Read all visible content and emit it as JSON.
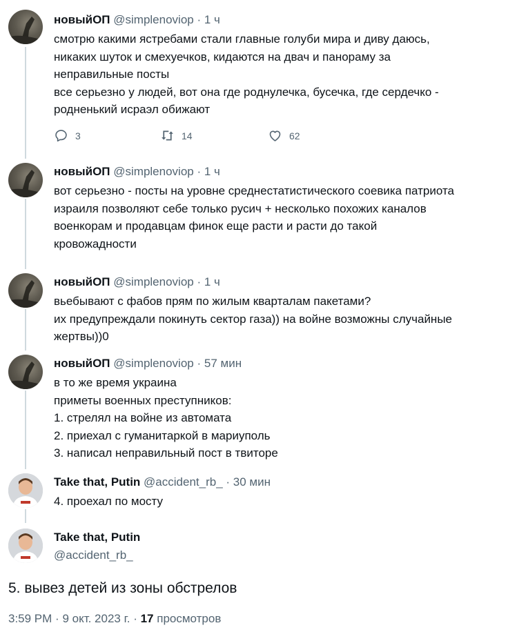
{
  "thread": [
    {
      "name": "новыйОП",
      "handle": "@simplenoviop",
      "sep": "·",
      "time": "1 ч",
      "lines": [
        "смотрю какими ястребами стали главные голуби мира и диву даюсь,",
        "никаких шуток и смехуечков, кидаются на двач и панораму за",
        "неправильные посты",
        "все серьезно у людей, вот она где роднулечка, бусечка, где сердечко -",
        "родненький исраэл обижают"
      ],
      "actions": {
        "replies": "3",
        "retweets": "14",
        "likes": "62"
      }
    },
    {
      "name": "новыйОП",
      "handle": "@simplenoviop",
      "sep": "·",
      "time": "1 ч",
      "lines": [
        "вот серьезно - посты на уровне среднестатистического соевика патриота",
        "израиля позволяют себе только русич + несколько похожих каналов",
        "военкорам и продавцам финок еще расти и расти до такой",
        "кровожадности"
      ]
    },
    {
      "name": "новыйОП",
      "handle": "@simplenoviop",
      "sep": "·",
      "time": "1 ч",
      "lines": [
        "вьебывают с фабов прям по жилым кварталам пакетами?",
        "их предупреждали покинуть сектор газа)) на войне возможны случайные",
        "жертвы))0"
      ]
    },
    {
      "name": "новыйОП",
      "handle": "@simplenoviop",
      "sep": "·",
      "time": "57 мин",
      "lines": [
        "в то же время украина",
        "приметы военных преступников:",
        "1. стрелял на войне из автомата",
        "2. приехал с гуманитаркой в мариуполь",
        "3. написал неправильный пост в твиторе"
      ]
    },
    {
      "name": "Take that, Putin",
      "handle": "@accident_rb_",
      "sep": "·",
      "time": "30 мин",
      "lines": [
        "4. проехал по мосту"
      ]
    }
  ],
  "main": {
    "name": "Take that, Putin",
    "handle": "@accident_rb_",
    "text": "5. вывез детей из зоны обстрелов",
    "time": "3:59 PM",
    "sep1": "·",
    "date": "9 окт. 2023 г.",
    "sep2": "·",
    "views_count": "17",
    "views_label": "просмотров"
  },
  "icons": {
    "reply": "reply-icon",
    "retweet": "retweet-icon",
    "like": "heart-icon"
  },
  "colors": {
    "text": "#0f1419",
    "secondary": "#536471",
    "thread_line": "#cfd9de"
  }
}
